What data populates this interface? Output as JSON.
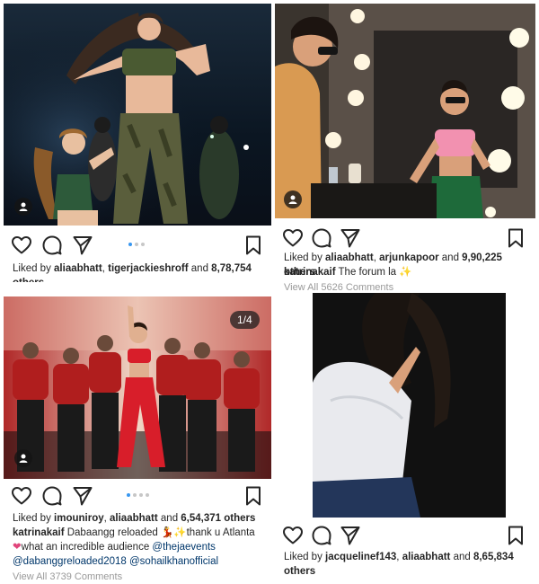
{
  "colors": {
    "accent": "#3897f0",
    "text": "#262626",
    "muted": "#999999",
    "link": "#00376b"
  },
  "posts": [
    {
      "liked_by_prefix": "Liked by ",
      "liked_user1": "aliaabhatt",
      "liked_sep": ", ",
      "liked_user2": "tigerjackieshroff",
      "liked_and": " and ",
      "likes_count": "8,78,754",
      "likes_suffix": "others",
      "carousel_position": 1,
      "carousel_total": 3
    },
    {
      "liked_by_prefix": "Liked by ",
      "liked_user1": "aliaabhatt",
      "liked_sep": ", ",
      "liked_user2": "arjunkapoor",
      "liked_and": " and ",
      "likes_count": "9,90,225",
      "likes_suffix": " others",
      "caption_user": "katrinakaif",
      "caption_text": " The forum la ",
      "caption_emoji": "✨",
      "view_comments": "View All 5626 Comments"
    },
    {
      "counter": "1/4",
      "liked_by_prefix": "Liked by ",
      "liked_user1": "imouniroy",
      "liked_sep": ", ",
      "liked_user2": "aliaabhatt",
      "liked_and": " and ",
      "likes_count": "6,54,371",
      "likes_suffix": " others",
      "caption_user": "katrinakaif",
      "caption_text_1": " Dabaangg reloaded ",
      "caption_emoji_1": "💃",
      "caption_text_2": "✨thank u Atlanta",
      "caption_emoji_2": "❤",
      "caption_text_3": "what an incredible audience ",
      "mention_1": "@thejaevents",
      "mention_2": "@dabanggreloaded2018",
      "mention_3": "@sohailkhanofficial",
      "view_comments": "View All 3739 Comments",
      "carousel_position": 1,
      "carousel_total": 4
    },
    {
      "liked_by_prefix": "Liked by ",
      "liked_user1": "jacquelinef143",
      "liked_sep": ", ",
      "liked_user2": "aliaabhatt",
      "liked_and": " and ",
      "likes_count": "8,65,834",
      "likes_suffix": "others"
    }
  ],
  "icons": {
    "like": "heart-icon",
    "comment": "comment-icon",
    "share": "send-icon",
    "save": "bookmark-icon",
    "tag": "user-tag-icon"
  }
}
